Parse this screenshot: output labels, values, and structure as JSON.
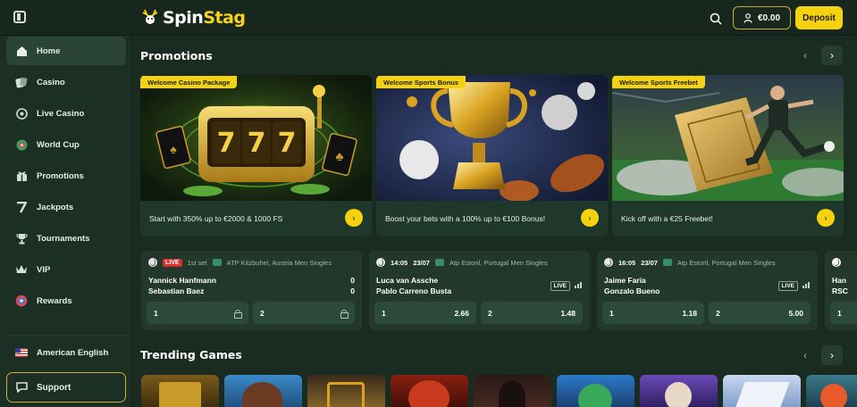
{
  "brand": {
    "name_part1": "Spin",
    "name_part2": "Stag"
  },
  "header": {
    "balance": "€0.00",
    "deposit_label": "Deposit"
  },
  "sidebar": {
    "items": [
      {
        "label": "Home",
        "icon": "home-icon"
      },
      {
        "label": "Casino",
        "icon": "casino-icon"
      },
      {
        "label": "Live Casino",
        "icon": "live-casino-icon"
      },
      {
        "label": "World Cup",
        "icon": "world-cup-icon"
      },
      {
        "label": "Promotions",
        "icon": "gift-icon"
      },
      {
        "label": "Jackpots",
        "icon": "seven-icon"
      },
      {
        "label": "Tournaments",
        "icon": "trophy-icon"
      },
      {
        "label": "VIP",
        "icon": "crown-icon"
      },
      {
        "label": "Rewards",
        "icon": "rewards-icon"
      }
    ],
    "language": "American English",
    "support": "Support"
  },
  "promotions": {
    "title": "Promotions",
    "cards": [
      {
        "tag": "Welcome Casino Package",
        "text": "Start with 350% up to €2000 & 1000 FS"
      },
      {
        "tag": "Welcome Sports Bonus",
        "text": "Boost your bets with a 100% up to €100 Bonus!"
      },
      {
        "tag": "Welcome Sports Freebet",
        "text": "Kick off with a €25 Freebet!"
      }
    ]
  },
  "matches": [
    {
      "status": "LIVE",
      "time": "1st set",
      "tournament": "ATP Kitzbuhel, Austria Men Singles",
      "home": "Yannick Hanfmann",
      "away": "Sebastian Baez",
      "home_score": "0",
      "away_score": "0",
      "odd1_label": "1",
      "odd2_label": "2"
    },
    {
      "time": "14:05",
      "date": "23/07",
      "tournament": "Atp Estoril, Portugal Men Singles",
      "home": "Luca van Assche",
      "away": "Pablo Carreno Busta",
      "live_label": "LIVE",
      "odd1_label": "1",
      "odd1": "2.66",
      "odd2_label": "2",
      "odd2": "1.48"
    },
    {
      "time": "16:05",
      "date": "23/07",
      "tournament": "Atp Estoril, Portugal Men Singles",
      "home": "Jaime Faria",
      "away": "Gonzalo Bueno",
      "live_label": "LIVE",
      "odd1_label": "1",
      "odd1": "1.18",
      "odd2_label": "2",
      "odd2": "5.00"
    },
    {
      "home": "Han",
      "away": "RSC",
      "odd1_label": "1"
    }
  ],
  "trending": {
    "title": "Trending Games"
  }
}
